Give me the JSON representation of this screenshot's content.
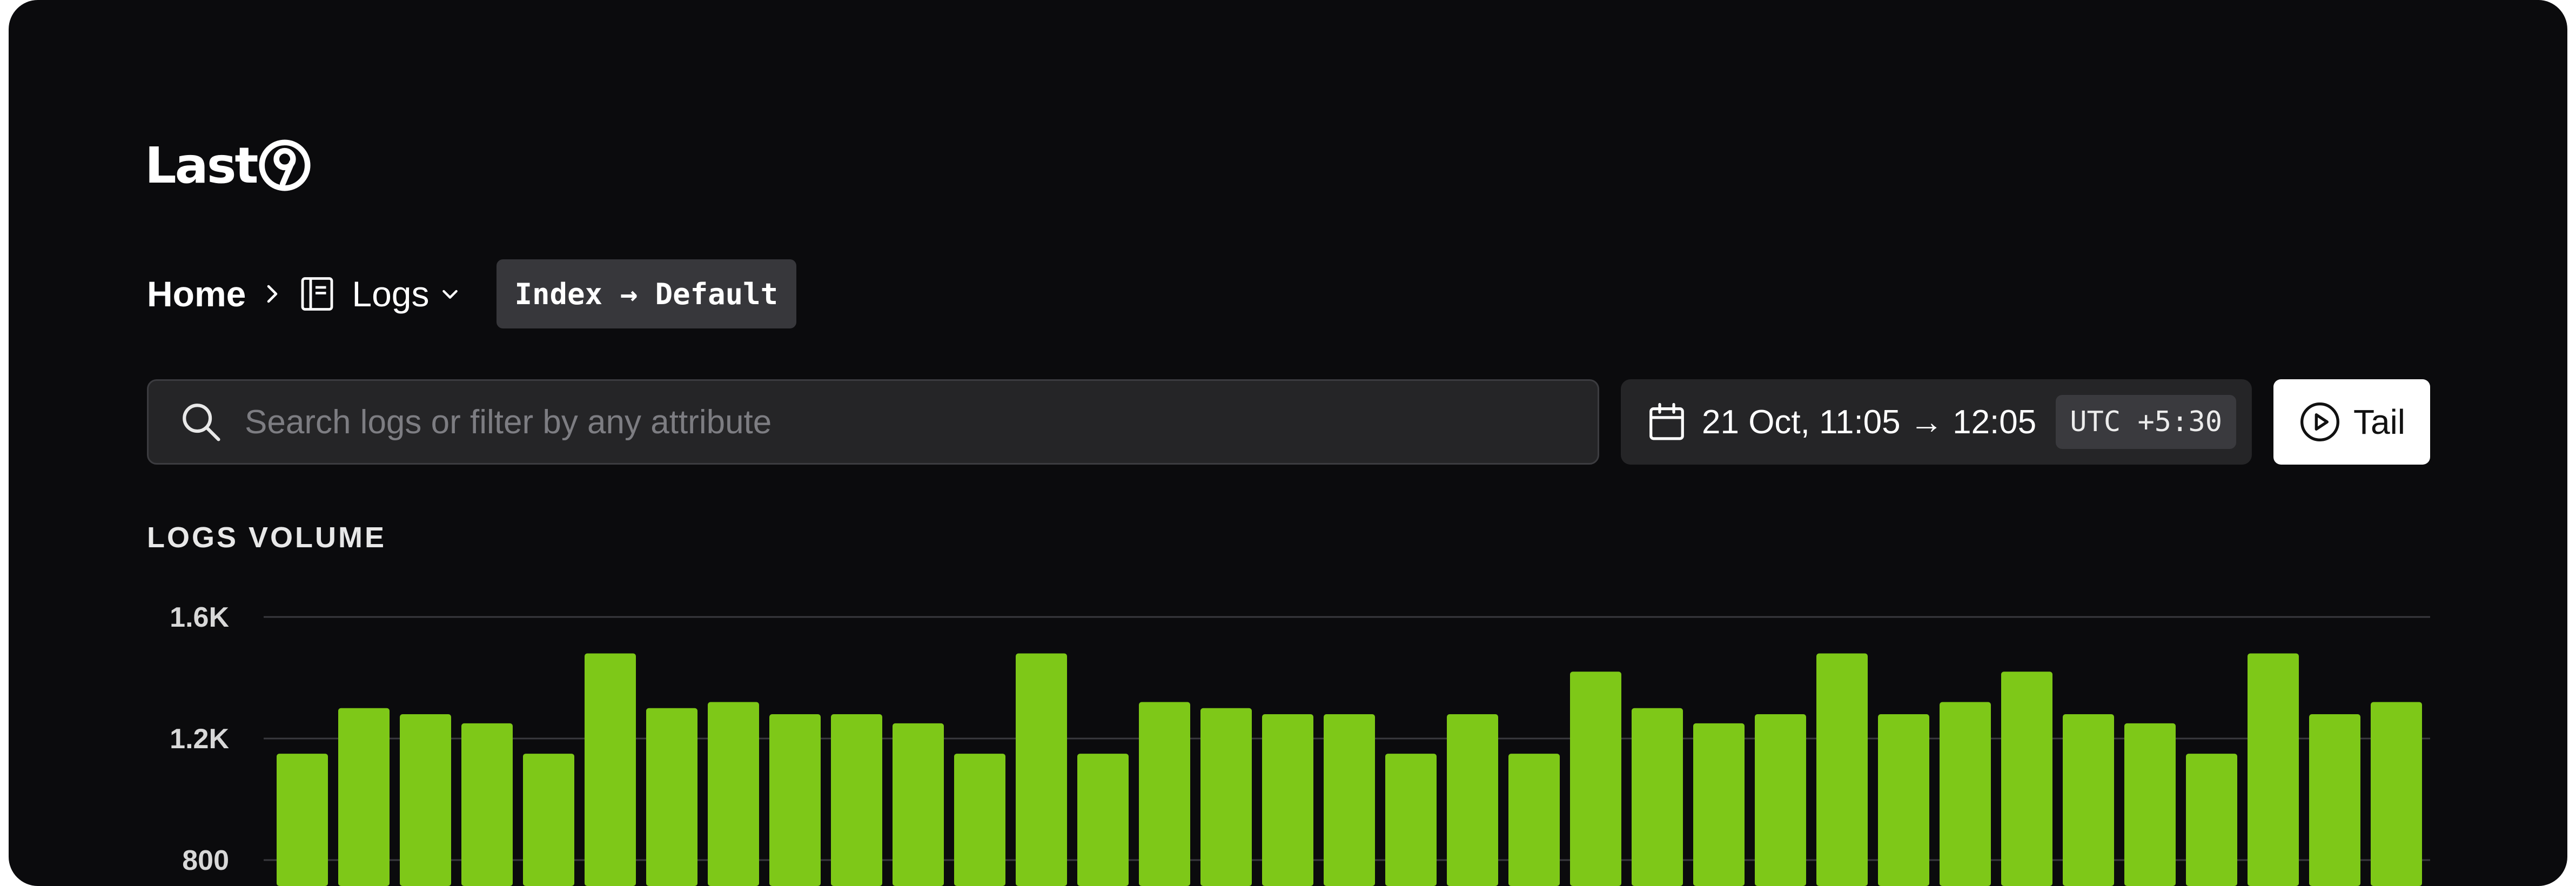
{
  "brand": {
    "name": "Last",
    "mark": "9"
  },
  "breadcrumb": {
    "home": "Home",
    "current": "Logs",
    "index_label": "Index → Default"
  },
  "search": {
    "placeholder": "Search logs or filter by any attribute",
    "value": ""
  },
  "time": {
    "range": "21 Oct, 11:05 → 12:05",
    "timezone": "UTC +5:30"
  },
  "tail": {
    "label": "Tail"
  },
  "section": {
    "title": "LOGS VOLUME"
  },
  "icons": {
    "breadcrumb_separator": "chevron-right-icon",
    "logs": "logs-book-icon",
    "dropdown": "chevron-down-icon",
    "search": "search-icon",
    "calendar": "calendar-icon",
    "play": "play-circle-icon"
  },
  "colors": {
    "background": "#0b0b0d",
    "bar": "#7ec818",
    "index_pill": "#37373b",
    "input_bg": "#252527"
  },
  "chart_data": {
    "type": "bar",
    "title": "LOGS VOLUME",
    "ytick_labels": [
      "1.6K",
      "1.2K",
      "800"
    ],
    "yticks": [
      1600,
      1200,
      800
    ],
    "ylim_visible": [
      800,
      1600
    ],
    "grid": true,
    "values": [
      1150,
      1300,
      1280,
      1250,
      1150,
      1480,
      1300,
      1320,
      1280,
      1280,
      1250,
      1150,
      1480,
      1150,
      1320,
      1300,
      1280,
      1280,
      1150,
      1280,
      1150,
      1420,
      1300,
      1250,
      1280,
      1480,
      1280,
      1320,
      1420,
      1280,
      1250,
      1150,
      1480,
      1280,
      1320
    ]
  }
}
